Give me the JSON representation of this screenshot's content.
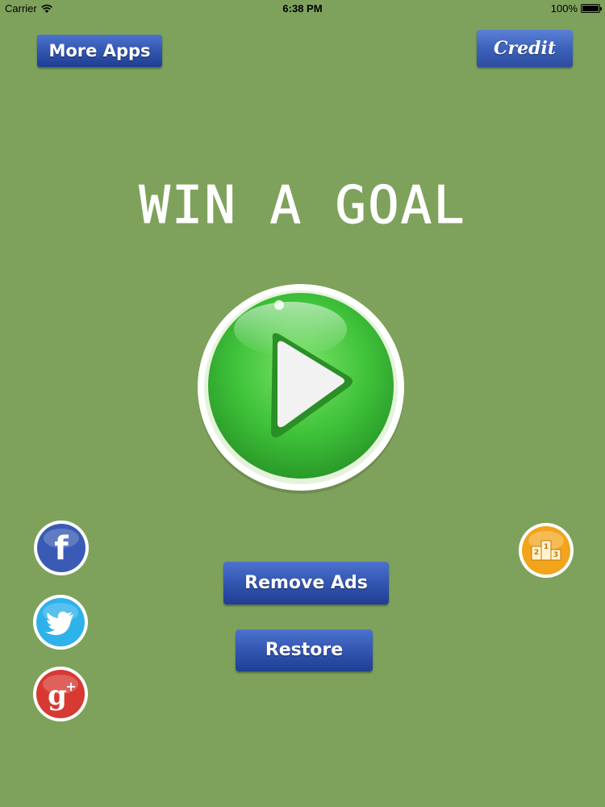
{
  "status_bar": {
    "carrier": "Carrier",
    "time": "6:38 PM",
    "battery": "100%"
  },
  "buttons": {
    "more_apps": "More Apps",
    "credit": "Credit",
    "remove_ads": "Remove Ads",
    "restore": "Restore"
  },
  "title": "WIN A GOAL",
  "icons": {
    "play": "play-icon",
    "facebook": "facebook-icon",
    "twitter": "twitter-icon",
    "google_plus": "google-plus-icon",
    "leaderboard": "leaderboard-icon"
  },
  "colors": {
    "background": "#7ea25b",
    "button_blue": "#3558b3",
    "play_green": "#3fc23a",
    "facebook": "#3a5bb5",
    "twitter": "#2fb2ea",
    "google_plus": "#d63a32",
    "leaderboard": "#f2a41b"
  }
}
